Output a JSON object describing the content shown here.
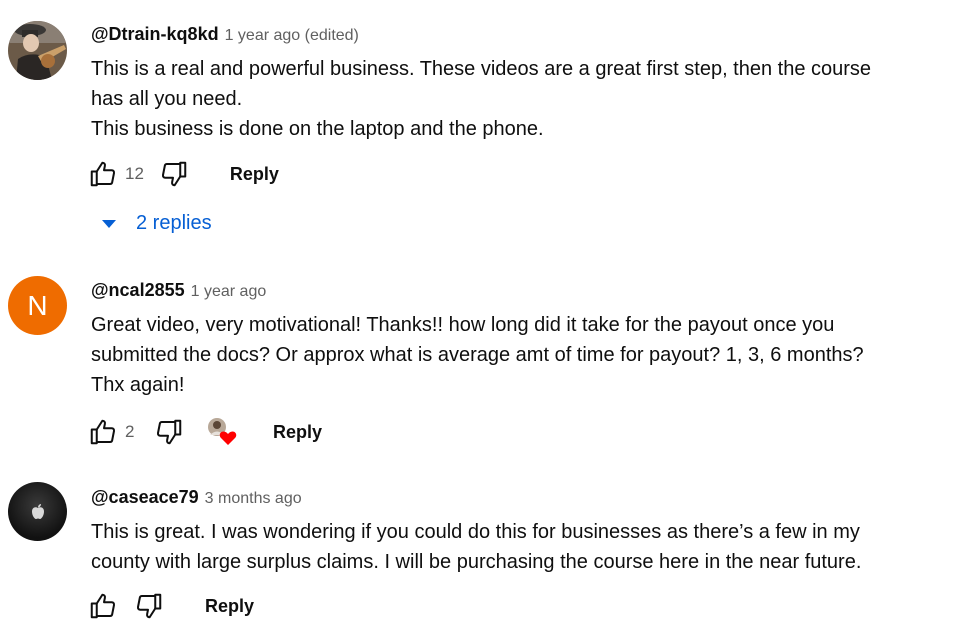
{
  "comments": [
    {
      "author": "@Dtrain-kq8kd",
      "time": "1 year ago (edited)",
      "text": "This is a real and powerful business. These videos are a great first step, then the course\nhas all you need.\nThis business is done on the laptop and the phone.",
      "likes": "12",
      "reply_label": "Reply",
      "replies_label": "2 replies"
    },
    {
      "author": "@ncal2855",
      "time": "1 year ago",
      "avatar_letter": "N",
      "avatar_color": "#ef6c00",
      "text": "Great video, very motivational! Thanks!! how long did it take for the payout once you\nsubmitted the docs?  Or approx what is average amt of time for payout? 1, 3, 6 months?\nThx again!",
      "likes": "2",
      "reply_label": "Reply"
    },
    {
      "author": "@caseace79",
      "time": "3 months ago",
      "text": "This is great. I was wondering if you could do this for businesses as there’s a few in my\ncounty with large surplus claims. I will be purchasing the course here in the near future.",
      "likes": "",
      "reply_label": "Reply"
    }
  ],
  "colors": {
    "link_blue": "#065fd4",
    "heart_red": "#ff0000",
    "meta_gray": "#606060"
  },
  "icons": [
    "thumb-up-icon",
    "thumb-down-icon",
    "caret-down-icon",
    "creator-heart-icon"
  ]
}
